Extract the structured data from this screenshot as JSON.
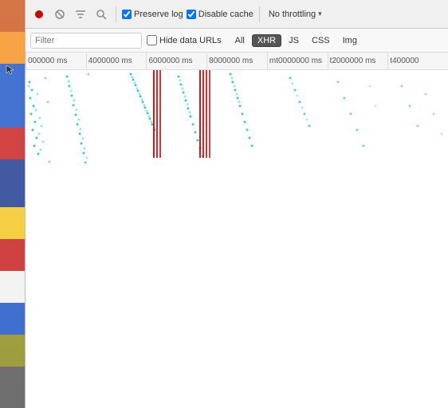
{
  "toolbar": {
    "record_btn": "⏺",
    "stop_btn": "⊘",
    "filter_btn": "filter",
    "search_btn": "search",
    "preserve_log_label": "Preserve log",
    "disable_cache_label": "Disable cache",
    "throttle_label": "No throttling",
    "preserve_log_checked": true,
    "disable_cache_checked": true
  },
  "filter_bar": {
    "placeholder": "Filter",
    "hide_data_urls_label": "Hide data URLs",
    "all_label": "All",
    "xhr_label": "XHR",
    "js_label": "JS",
    "css_label": "CSS",
    "img_label": "Img"
  },
  "timeline": {
    "labels": [
      "000000 ms",
      "4000000 ms",
      "6000000 ms",
      "8000000 ms",
      "mt0000000 ms",
      "t2000000 ms",
      "t400000"
    ]
  }
}
